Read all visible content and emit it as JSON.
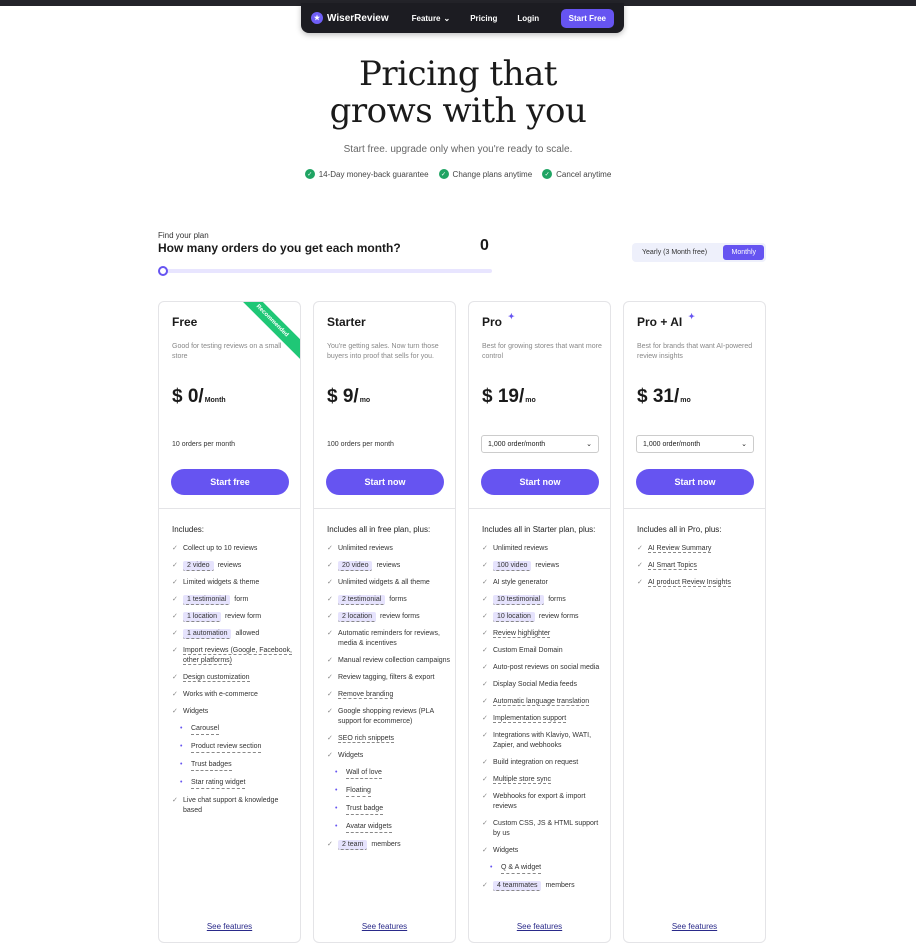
{
  "nav": {
    "logo": "WiserReview",
    "links": [
      "Feature",
      "Pricing",
      "Login"
    ],
    "cta": "Start Free"
  },
  "hero": {
    "title_line1": "Pricing that",
    "title_line2": "grows with you",
    "subtitle": "Start free. upgrade only when you're ready to scale.",
    "badges": [
      "14-Day money-back guarantee",
      "Change plans anytime",
      "Cancel anytime"
    ]
  },
  "finder": {
    "eyebrow": "Find your plan",
    "question": "How many orders do you get each month?",
    "value": "0",
    "slider_fraction": 0
  },
  "billing_toggle": {
    "yearly": "Yearly (3 Month free)",
    "monthly": "Monthly",
    "selected": "Monthly"
  },
  "plans": [
    {
      "name": "Free",
      "ribbon": "Recommended",
      "desc": "Good for testing reviews on a small store",
      "price": "$ 0/",
      "unit": "Month",
      "orders": "10 orders per month",
      "cta": "Start free",
      "includes": "Includes:",
      "features": [
        {
          "text": "Collect up to 10 reviews"
        },
        {
          "pill": "2 video",
          "text": "reviews"
        },
        {
          "text": "Limited widgets & theme"
        },
        {
          "pill": "1 testimonial",
          "text": "form"
        },
        {
          "pill": "1 location",
          "text": "review form"
        },
        {
          "pill": "1 automation",
          "text": "allowed"
        },
        {
          "text": "Import reviews (Google, Facebook, other platforms)",
          "dashed": true
        },
        {
          "text": "Design customization",
          "dashed": true
        },
        {
          "text": "Works with e-commerce"
        },
        {
          "text": "Widgets",
          "sub": [
            "Carousel",
            "Product review section",
            "Trust badges",
            "Star rating widget"
          ]
        },
        {
          "text": "Live chat support & knowledge based"
        }
      ],
      "see_features": "See features"
    },
    {
      "name": "Starter",
      "desc": "You're getting sales. Now turn those buyers into proof that sells for you.",
      "price": "$ 9/",
      "unit": "mo",
      "orders": "100 orders per month",
      "cta": "Start now",
      "includes": "Includes all in free plan, plus:",
      "features": [
        {
          "text": "Unlimited reviews"
        },
        {
          "pill": "20 video",
          "text": "reviews"
        },
        {
          "text": "Unlimited widgets & all theme"
        },
        {
          "pill": "2 testimonial",
          "text": "forms"
        },
        {
          "pill": "2 location",
          "text": "review forms"
        },
        {
          "text": "Automatic reminders for reviews, media & incentives"
        },
        {
          "text": "Manual review collection campaigns"
        },
        {
          "text": "Review tagging, filters & export"
        },
        {
          "text": "Remove branding",
          "dashed": true
        },
        {
          "text": "Google shopping reviews (PLA support for ecommerce)"
        },
        {
          "text": "SEO rich snippets",
          "dashed": true
        },
        {
          "text": "Widgets",
          "sub": [
            "Wall of love",
            "Floating",
            "Trust badge",
            "Avatar widgets"
          ]
        },
        {
          "pill": "2 team",
          "text": "members"
        }
      ],
      "see_features": "See features"
    },
    {
      "name": "Pro",
      "ai": true,
      "desc": "Best for growing stores that want more control",
      "price": "$ 19/",
      "unit": "mo",
      "select": "1,000 order/month",
      "cta": "Start now",
      "includes": "Includes all in Starter plan, plus:",
      "features": [
        {
          "text": "Unlimited reviews"
        },
        {
          "pill": "100 video",
          "text": "reviews"
        },
        {
          "text": "AI style generator"
        },
        {
          "pill": "10 testimonial",
          "text": "forms"
        },
        {
          "pill": "10 location",
          "text": "review forms"
        },
        {
          "text": "Review highlighter",
          "dashed": true
        },
        {
          "text": "Custom Email Domain"
        },
        {
          "text": "Auto-post reviews on social media"
        },
        {
          "text": "Display Social Media feeds"
        },
        {
          "text": "Automatic language translation",
          "dashed": true
        },
        {
          "text": "Implementation support",
          "dashed": true
        },
        {
          "text": "Integrations with Klaviyo, WATI, Zapier, and webhooks"
        },
        {
          "text": "Build integration on request"
        },
        {
          "text": "Multiple store sync",
          "dashed": true
        },
        {
          "text": "Webhooks for export & import reviews"
        },
        {
          "text": "Custom CSS, JS & HTML support by us"
        },
        {
          "text": "Widgets",
          "sub": [
            "Q & A widget"
          ]
        },
        {
          "pill": "4 teammates",
          "text": "members"
        }
      ],
      "see_features": "See features"
    },
    {
      "name": "Pro + AI",
      "ai": true,
      "desc": "Best for brands that want AI-powered review insights",
      "price": "$ 31/",
      "unit": "mo",
      "select": "1,000 order/month",
      "cta": "Start now",
      "includes": "Includes all in Pro, plus:",
      "features": [
        {
          "text": "AI Review Summary",
          "dashed": true
        },
        {
          "text": "AI Smart Topics",
          "dashed": true
        },
        {
          "text": "AI product Review Insights",
          "dashed": true
        }
      ],
      "see_features": "See features"
    }
  ]
}
